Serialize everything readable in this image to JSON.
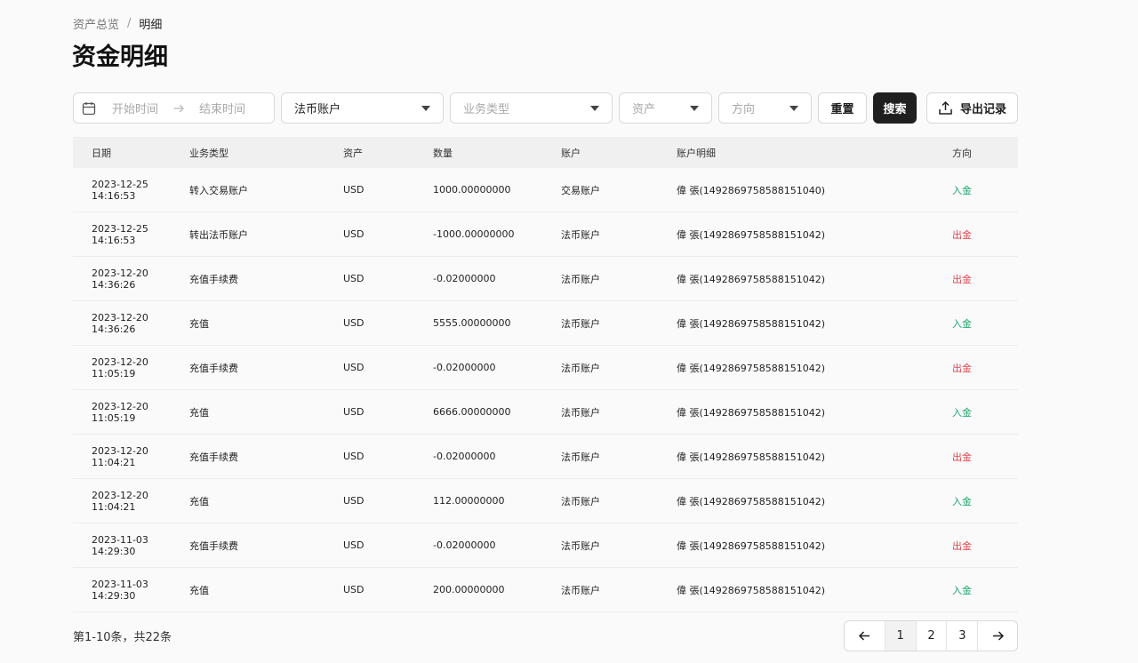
{
  "breadcrumb": {
    "parent": "资产总览",
    "separator": "/",
    "current": "明细"
  },
  "page_title": "资金明细",
  "filters": {
    "date_start_placeholder": "开始时间",
    "date_end_placeholder": "结束时间",
    "account_value": "法币账户",
    "biz_type_placeholder": "业务类型",
    "asset_placeholder": "资产",
    "direction_placeholder": "方向",
    "reset_label": "重置",
    "search_label": "搜索",
    "export_label": "导出记录"
  },
  "table": {
    "headers": {
      "date": "日期",
      "biz": "业务类型",
      "asset": "资产",
      "qty": "数量",
      "acct": "账户",
      "detail": "账户明细",
      "dir": "方向"
    },
    "rows": [
      {
        "date": "2023-12-25 14:16:53",
        "biz": "转入交易账户",
        "asset": "USD",
        "qty": "1000.00000000",
        "acct": "交易账户",
        "detail": "偉 張(1492869758588151040)",
        "dir": "入金",
        "dir_type": "in"
      },
      {
        "date": "2023-12-25 14:16:53",
        "biz": "转出法币账户",
        "asset": "USD",
        "qty": "-1000.00000000",
        "acct": "法币账户",
        "detail": "偉 張(1492869758588151042)",
        "dir": "出金",
        "dir_type": "out"
      },
      {
        "date": "2023-12-20 14:36:26",
        "biz": "充值手续费",
        "asset": "USD",
        "qty": "-0.02000000",
        "acct": "法币账户",
        "detail": "偉 張(1492869758588151042)",
        "dir": "出金",
        "dir_type": "out"
      },
      {
        "date": "2023-12-20 14:36:26",
        "biz": "充值",
        "asset": "USD",
        "qty": "5555.00000000",
        "acct": "法币账户",
        "detail": "偉 張(1492869758588151042)",
        "dir": "入金",
        "dir_type": "in"
      },
      {
        "date": "2023-12-20 11:05:19",
        "biz": "充值手续费",
        "asset": "USD",
        "qty": "-0.02000000",
        "acct": "法币账户",
        "detail": "偉 張(1492869758588151042)",
        "dir": "出金",
        "dir_type": "out"
      },
      {
        "date": "2023-12-20 11:05:19",
        "biz": "充值",
        "asset": "USD",
        "qty": "6666.00000000",
        "acct": "法币账户",
        "detail": "偉 張(1492869758588151042)",
        "dir": "入金",
        "dir_type": "in"
      },
      {
        "date": "2023-12-20 11:04:21",
        "biz": "充值手续费",
        "asset": "USD",
        "qty": "-0.02000000",
        "acct": "法币账户",
        "detail": "偉 張(1492869758588151042)",
        "dir": "出金",
        "dir_type": "out"
      },
      {
        "date": "2023-12-20 11:04:21",
        "biz": "充值",
        "asset": "USD",
        "qty": "112.00000000",
        "acct": "法币账户",
        "detail": "偉 張(1492869758588151042)",
        "dir": "入金",
        "dir_type": "in"
      },
      {
        "date": "2023-11-03 14:29:30",
        "biz": "充值手续费",
        "asset": "USD",
        "qty": "-0.02000000",
        "acct": "法币账户",
        "detail": "偉 張(1492869758588151042)",
        "dir": "出金",
        "dir_type": "out"
      },
      {
        "date": "2023-11-03 14:29:30",
        "biz": "充值",
        "asset": "USD",
        "qty": "200.00000000",
        "acct": "法币账户",
        "detail": "偉 張(1492869758588151042)",
        "dir": "入金",
        "dir_type": "in"
      }
    ]
  },
  "pagination": {
    "summary": "第1-10条，共22条",
    "pages": [
      "1",
      "2",
      "3"
    ],
    "current_page": "1"
  },
  "colors": {
    "in": "#1aa36b",
    "out": "#e0444f",
    "primary_button": "#1f1f1f"
  },
  "icons": {
    "date": "calendar-icon",
    "range": "arrow-right-icon",
    "export": "upload-icon",
    "prev": "arrow-left-icon",
    "next": "arrow-right-icon"
  }
}
